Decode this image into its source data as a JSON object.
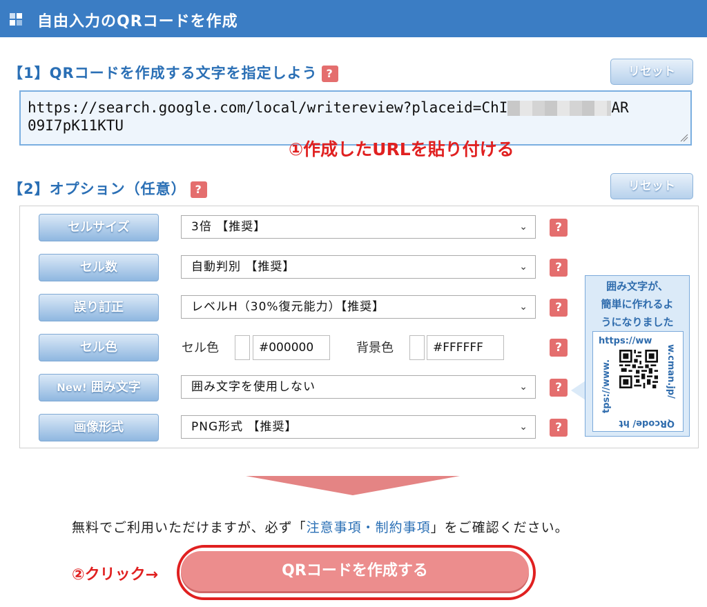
{
  "header": {
    "title": "自由入力のQRコードを作成"
  },
  "section1": {
    "title": "【1】QRコードを作成する文字を指定しよう",
    "help": "?",
    "reset_label": "リセット",
    "url_text_before": "https://search.google.com/local/writereview?placeid=ChI",
    "url_text_after": "AR",
    "url_line2": "09I7pK11KTU",
    "annotation": "①作成したURLを貼り付ける"
  },
  "section2": {
    "title": "【2】オプション（任意）",
    "help": "?",
    "reset_label": "リセット"
  },
  "options": {
    "cell_size": {
      "label": "セルサイズ",
      "value": "3倍 【推奨】",
      "help": "?"
    },
    "cell_count": {
      "label": "セル数",
      "value": "自動判別 【推奨】",
      "help": "?"
    },
    "error_correction": {
      "label": "誤り訂正",
      "value": "レベルH（30%復元能力）【推奨】",
      "help": "?"
    },
    "cell_color": {
      "label": "セル色",
      "cell_color_label": "セル色",
      "cell_color_value": "#000000",
      "bg_color_label": "背景色",
      "bg_color_value": "#FFFFFF",
      "help": "?"
    },
    "frame_text": {
      "new_badge": "New!",
      "label": "囲み文字",
      "value": "囲み文字を使用しない",
      "help": "?"
    },
    "image_format": {
      "label": "画像形式",
      "value": "PNG形式 【推奨】",
      "help": "?"
    }
  },
  "callout": {
    "line1": "囲み文字が、",
    "line2": "簡単に作れるよ",
    "line3": "うになりました",
    "qr_top": "https://ww",
    "qr_right": "w.cman.jp/",
    "qr_bottom": "QRcode/ ht",
    "qr_left": "tps://www."
  },
  "notice": {
    "before": "無料でご利用いただけますが、必ず「",
    "link": "注意事項・制約事項",
    "after": "」をご確認ください。"
  },
  "create": {
    "annotation": "②クリック→",
    "button_label": "QRコードを作成する"
  },
  "colors": {
    "header_bg": "#3b7dc4",
    "title_blue": "#2a6fb5",
    "help_red": "#e46e6e",
    "annotation_red": "#e02020",
    "create_button": "#ec8d8d"
  }
}
